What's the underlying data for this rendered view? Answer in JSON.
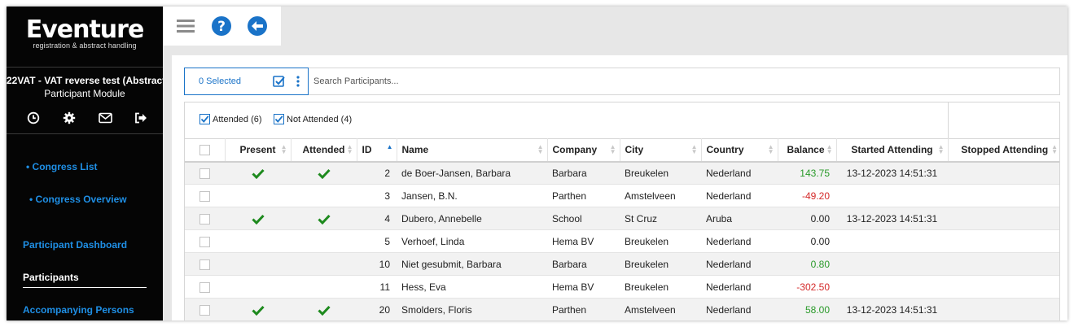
{
  "sidebar": {
    "logo_title": "Eventure",
    "logo_subtitle": "registration & abstract handling",
    "event_name": "22VAT - VAT reverse test (Abstract...",
    "module_name": "Participant Module",
    "nav": {
      "congress_list": "• Congress List",
      "congress_overview": "• Congress Overview",
      "participant_dashboard": "Participant Dashboard",
      "participants": "Participants",
      "accompanying_persons": "Accompanying Persons"
    }
  },
  "toolbar": {
    "menu_icon": "hamburger-icon",
    "help_icon": "question-icon",
    "back_icon": "arrow-left-icon"
  },
  "selection": {
    "label": "0 Selected"
  },
  "search": {
    "placeholder": "Search Participants..."
  },
  "filters": {
    "attended": "Attended (6)",
    "not_attended": "Not Attended (4)"
  },
  "table": {
    "headers": {
      "present": "Present",
      "attended": "Attended",
      "id": "ID",
      "name": "Name",
      "company": "Company",
      "city": "City",
      "country": "Country",
      "balance": "Balance",
      "started": "Started Attending",
      "stopped": "Stopped Attending"
    },
    "rows": [
      {
        "present": true,
        "attended": true,
        "id": "2",
        "name": "de Boer-Jansen, Barbara",
        "company": "Barbara",
        "city": "Breukelen",
        "country": "Nederland",
        "balance": "143.75",
        "balance_sign": "pos",
        "started": "13-12-2023 14:51:31",
        "stopped": ""
      },
      {
        "present": false,
        "attended": false,
        "id": "3",
        "name": "Jansen, B.N.",
        "company": "Parthen",
        "city": "Amstelveen",
        "country": "Nederland",
        "balance": "-49.20",
        "balance_sign": "neg",
        "started": "",
        "stopped": ""
      },
      {
        "present": true,
        "attended": true,
        "id": "4",
        "name": "Dubero, Annebelle",
        "company": "School",
        "city": "St Cruz",
        "country": "Aruba",
        "balance": "0.00",
        "balance_sign": "zero",
        "started": "13-12-2023 14:51:31",
        "stopped": ""
      },
      {
        "present": false,
        "attended": false,
        "id": "5",
        "name": "Verhoef, Linda",
        "company": "Hema BV",
        "city": "Breukelen",
        "country": "Nederland",
        "balance": "0.00",
        "balance_sign": "zero",
        "started": "",
        "stopped": ""
      },
      {
        "present": false,
        "attended": false,
        "id": "10",
        "name": "Niet gesubmit, Barbara",
        "company": "Barbara",
        "city": "Breukelen",
        "country": "Nederland",
        "balance": "0.80",
        "balance_sign": "pos",
        "started": "",
        "stopped": ""
      },
      {
        "present": false,
        "attended": false,
        "id": "11",
        "name": "Hess, Eva",
        "company": "Hema BV",
        "city": "Breukelen",
        "country": "Nederland",
        "balance": "-302.50",
        "balance_sign": "neg",
        "started": "",
        "stopped": ""
      },
      {
        "present": true,
        "attended": true,
        "id": "20",
        "name": "Smolders, Floris",
        "company": "Parthen",
        "city": "Amstelveen",
        "country": "Nederland",
        "balance": "58.00",
        "balance_sign": "pos",
        "started": "13-12-2023 14:51:31",
        "stopped": ""
      }
    ]
  },
  "colors": {
    "accent": "#1a73c8",
    "link": "#1f8fe5",
    "positive": "#2a9a2a",
    "negative": "#d42a2a",
    "check": "#1e8a1e"
  }
}
